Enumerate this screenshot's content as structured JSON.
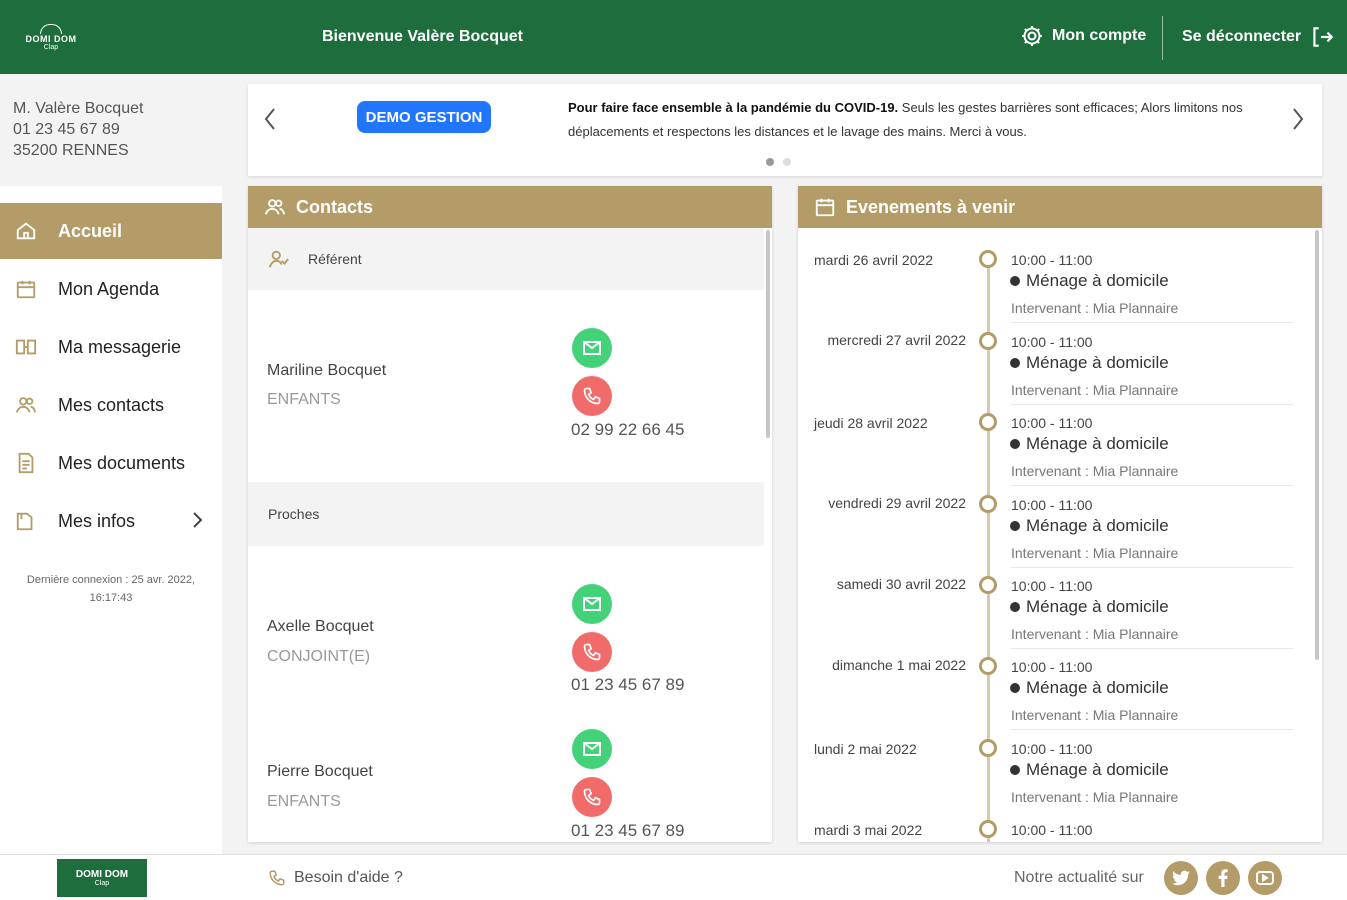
{
  "header": {
    "logo_text": "DOMI DOM",
    "logo_tag": "Clap",
    "welcome": "Bienvenue Valère Bocquet",
    "account_label": "Mon compte",
    "logout_label": "Se déconnecter"
  },
  "user": {
    "name": "M. Valère Bocquet",
    "phone": "01 23 45 67 89",
    "city": "35200 RENNES"
  },
  "nav": {
    "items": [
      {
        "label": "Accueil",
        "icon": "home-icon"
      },
      {
        "label": "Mon Agenda",
        "icon": "calendar-icon"
      },
      {
        "label": "Ma messagerie",
        "icon": "book-icon"
      },
      {
        "label": "Mes contacts",
        "icon": "contacts-icon"
      },
      {
        "label": "Mes documents",
        "icon": "document-icon"
      },
      {
        "label": "Mes infos",
        "icon": "folder-icon"
      }
    ],
    "last_login": "Dernière connexion : 25 avr. 2022, 16:17:43"
  },
  "banner": {
    "badge": "DEMO GESTION",
    "text_bold": "Pour faire face ensemble à la pandémie du COVID-19.",
    "text_rest": " Seuls les gestes barrières sont efficaces; Alors limitons nos déplacements et respectons les distances et le lavage des mains. Merci à vous.",
    "slides": 2,
    "active_slide": 1
  },
  "contacts": {
    "title": "Contacts",
    "referent_label": "Référent",
    "proches_label": "Proches",
    "list": [
      {
        "name": "Mariline Bocquet",
        "relation": "ENFANTS",
        "phone": "02 99 22 66 45"
      },
      {
        "name": "Axelle Bocquet",
        "relation": "CONJOINT(E)",
        "phone": "01 23 45 67 89"
      },
      {
        "name": "Pierre Bocquet",
        "relation": "ENFANTS",
        "phone": "01 23 45 67 89"
      }
    ]
  },
  "events": {
    "title": "Evenements à venir",
    "list": [
      {
        "date": "mardi 26 avril 2022",
        "time": "10:00 - 11:00",
        "title": "Ménage à domicile",
        "who": "Intervenant : Mia Plannaire"
      },
      {
        "date": "mercredi 27 avril 2022",
        "time": "10:00 - 11:00",
        "title": "Ménage à domicile",
        "who": "Intervenant : Mia Plannaire"
      },
      {
        "date": "jeudi 28 avril 2022",
        "time": "10:00 - 11:00",
        "title": "Ménage à domicile",
        "who": "Intervenant : Mia Plannaire"
      },
      {
        "date": "vendredi 29 avril 2022",
        "time": "10:00 - 11:00",
        "title": "Ménage à domicile",
        "who": "Intervenant : Mia Plannaire"
      },
      {
        "date": "samedi 30 avril 2022",
        "time": "10:00 - 11:00",
        "title": "Ménage à domicile",
        "who": "Intervenant : Mia Plannaire"
      },
      {
        "date": "dimanche 1 mai 2022",
        "time": "10:00 - 11:00",
        "title": "Ménage à domicile",
        "who": "Intervenant : Mia Plannaire"
      },
      {
        "date": "lundi 2 mai 2022",
        "time": "10:00 - 11:00",
        "title": "Ménage à domicile",
        "who": "Intervenant : Mia Plannaire"
      },
      {
        "date": "mardi 3 mai 2022",
        "time": "10:00 - 11:00",
        "title": "",
        "who": ""
      }
    ]
  },
  "footer": {
    "logo_text": "DOMI DOM",
    "logo_tag": "Clap",
    "help_label": "Besoin d'aide ?",
    "news_label": "Notre actualité sur",
    "social": [
      "twitter-icon",
      "facebook-icon",
      "youtube-icon"
    ]
  },
  "colors": {
    "brand_green": "#1d6e3c",
    "accent_gold": "#b39c68",
    "mail_green": "#43d17a",
    "phone_red": "#f26b6b",
    "badge_blue": "#2176ff"
  }
}
